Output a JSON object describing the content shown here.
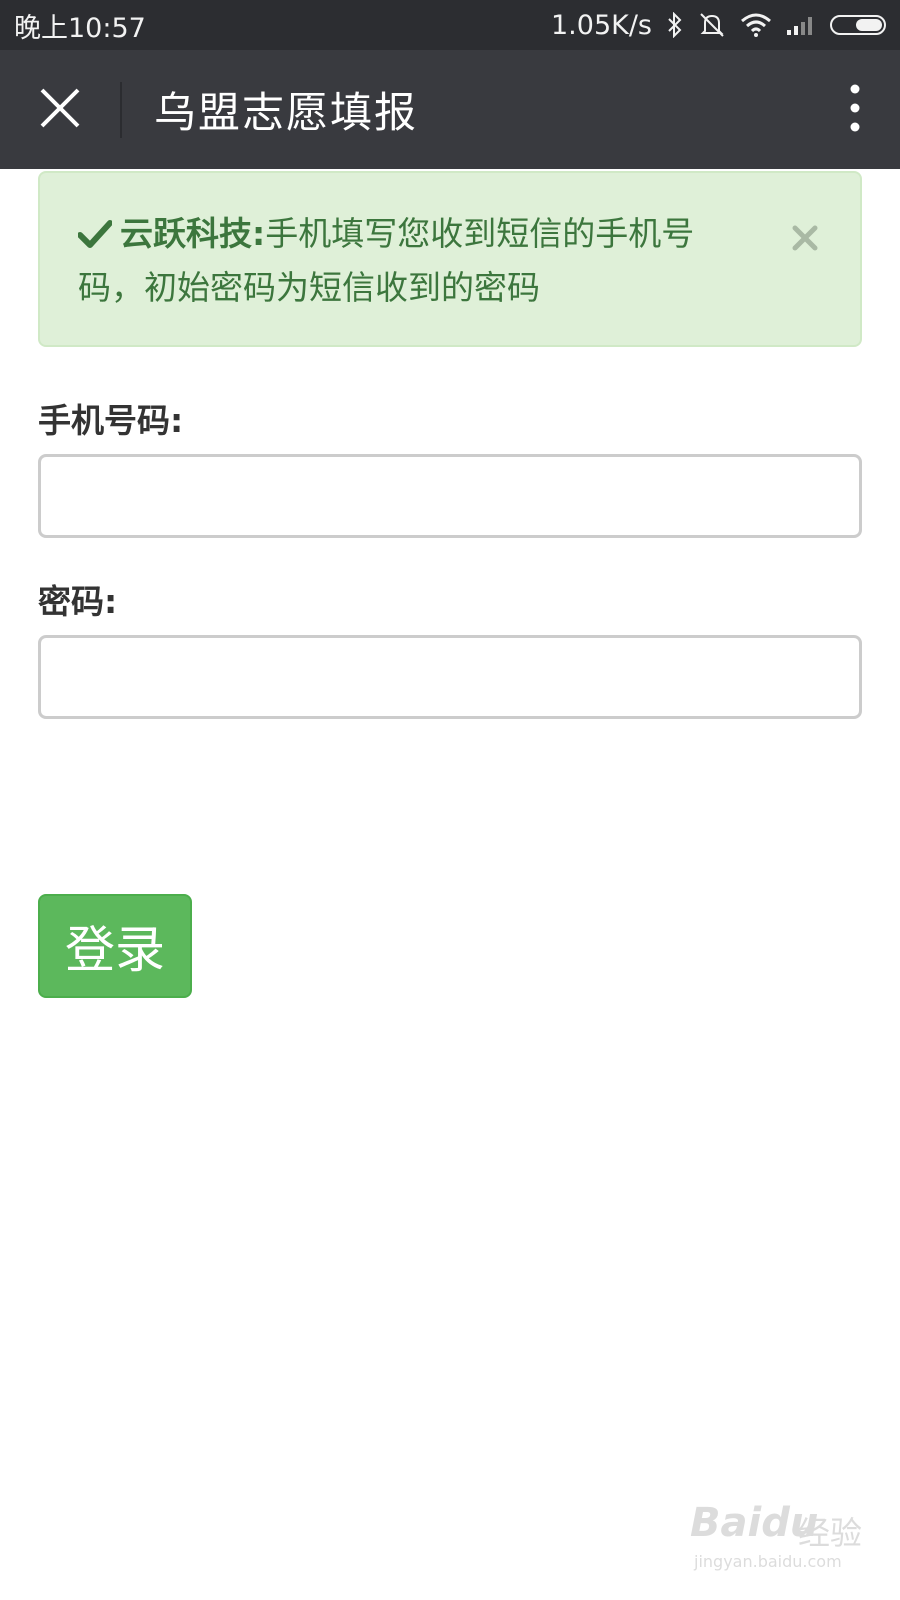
{
  "status_bar": {
    "time": "晚上10:57",
    "net_speed": "1.05K/s",
    "icons": [
      "bluetooth-icon",
      "mute-icon",
      "wifi-icon",
      "signal-icon",
      "battery-icon"
    ]
  },
  "title_bar": {
    "title": "乌盟志愿填报",
    "close_icon": "close-icon",
    "more_icon": "more-vertical-icon"
  },
  "alert": {
    "brand": "云跃科技:",
    "message": "手机填写您收到短信的手机号码，初始密码为短信收到的密码",
    "icon": "check-icon",
    "close_icon": "close-icon"
  },
  "form": {
    "phone_label": "手机号码:",
    "phone_value": "",
    "password_label": "密码:",
    "password_value": "",
    "submit_label": "登录"
  },
  "watermark": {
    "brand": "Baidu",
    "brand_cn": "经验",
    "url": "jingyan.baidu.com"
  },
  "colors": {
    "status_bar_bg": "#2c2d31",
    "title_bar_bg": "#393a3f",
    "alert_bg": "#dff0d8",
    "alert_text": "#3c763d",
    "button_bg": "#5cb85c"
  }
}
